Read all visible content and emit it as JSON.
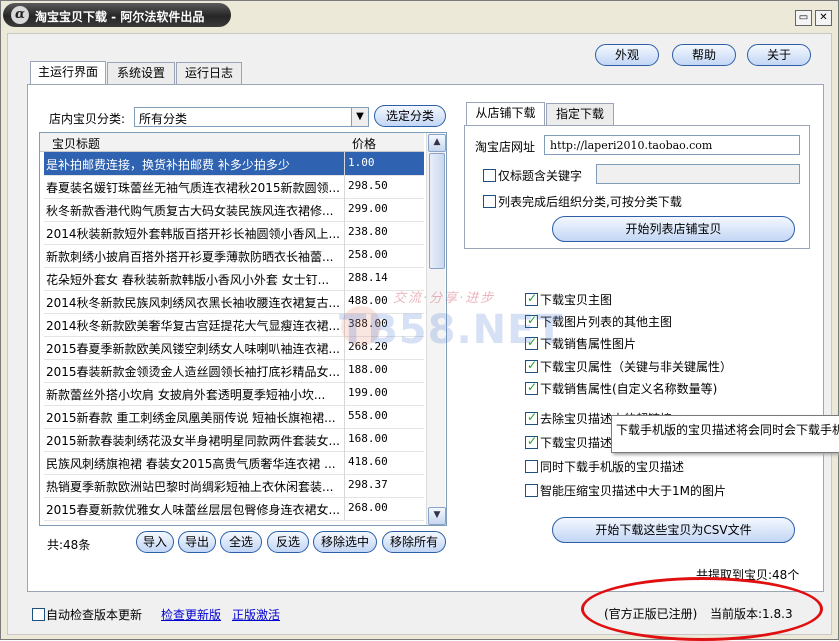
{
  "title": "淘宝宝贝下载 - 阿尔法软件出品",
  "logo_char": "α",
  "window_buttons": {
    "minimize": "▭",
    "close": "✕"
  },
  "top_buttons": [
    "外观",
    "帮助",
    "关于"
  ],
  "main_tabs": [
    "主运行界面",
    "系统设置",
    "运行日志"
  ],
  "category": {
    "label": "店内宝贝分类:",
    "value": "所有分类",
    "button": "选定分类"
  },
  "list": {
    "columns": [
      "宝贝标题",
      "价格"
    ],
    "rows": [
      {
        "title": "是补拍邮费连接，换货补拍邮费 补多少拍多少",
        "price": "1.00"
      },
      {
        "title": "春夏装名媛钉珠蕾丝无袖气质连衣裙秋2015新款圆领...",
        "price": "298.50"
      },
      {
        "title": "秋冬新款香港代购气质复古大码女装民族风连衣裙修...",
        "price": "299.00"
      },
      {
        "title": "2014秋装新款短外套韩版百搭开衫长袖圆领小香风上...",
        "price": "238.80"
      },
      {
        "title": "新款刺绣小披肩百搭外搭开衫夏季薄款防晒衣长袖蕾...",
        "price": "258.00"
      },
      {
        "title": "花朵短外套女 春秋装新款韩版小香风小外套 女士钉...",
        "price": "288.14"
      },
      {
        "title": "2014秋冬新款民族风刺绣风衣黑长袖收腰连衣裙复古...",
        "price": "488.00"
      },
      {
        "title": "2014秋冬新款欧美奢华复古宫廷提花大气显瘦连衣裙...",
        "price": "388.00"
      },
      {
        "title": "2015春夏季新款欧美风镂空刺绣女人味喇叭袖连衣裙...",
        "price": "268.20"
      },
      {
        "title": "2015春装新款金领烫金人造丝圆领长袖打底衫精品女...",
        "price": "188.00"
      },
      {
        "title": "新款蕾丝外搭小坎肩 女披肩外套透明夏季短袖小坎...",
        "price": "199.00"
      },
      {
        "title": "2015新春款 重工刺绣金凤凰美丽传说 短袖长旗袍裙...",
        "price": "558.00"
      },
      {
        "title": "2015新款春装刺绣花汲女半身裙明星同款两件套装女...",
        "price": "168.00"
      },
      {
        "title": "民族风刺绣旗袍裙 春装女2015高贵气质奢华连衣裙 ...",
        "price": "418.60"
      },
      {
        "title": "热销夏季新款欧洲站巴黎时尚绸彩短袖上衣休闲套装...",
        "price": "298.37"
      },
      {
        "title": "2015春夏新款优雅女人味蕾丝层层包臀修身连衣裙女...",
        "price": "268.00"
      }
    ]
  },
  "list_footer": {
    "count": "共:48条",
    "buttons": [
      "导入",
      "导出",
      "全选",
      "反选",
      "移除选中",
      "移除所有"
    ]
  },
  "right_tabs": [
    "从店铺下载",
    "指定下载"
  ],
  "shop": {
    "url_label": "淘宝店网址",
    "url_value": "http://laperi2010.taobao.com",
    "only_title_label": "仅标题含关键字",
    "only_title_checked": false,
    "organize_label": "列表完成后组织分类,可按分类下载",
    "organize_checked": false,
    "start_button": "开始列表店铺宝贝"
  },
  "options": [
    {
      "label": "下载宝贝主图",
      "checked": true
    },
    {
      "label": "下载图片列表的其他主图",
      "checked": true
    },
    {
      "label": "下载销售属性图片",
      "checked": true
    },
    {
      "label": "下载宝贝属性（关键与非关键属性）",
      "checked": true
    },
    {
      "label": "下载销售属性(自定义名称数量等)",
      "checked": true
    },
    {
      "label": "去除宝贝描述中的超链接",
      "checked": true
    },
    {
      "label": "下载宝贝描述中的图片用于图片搬家",
      "checked": true
    },
    {
      "label": "同时下载手机版的宝贝描述",
      "checked": false
    },
    {
      "label": "智能压缩宝贝描述中大于1M的图片",
      "checked": false
    }
  ],
  "tooltip": "下载手机版的宝贝描述将会同时会下载手机",
  "export_button": "开始下载这些宝贝为CSV文件",
  "total_status": "共提取到宝贝:48个",
  "footer": {
    "auto_check_label": "自动检查版本更新",
    "auto_check_checked": false,
    "check_update": "检查更新版",
    "activate": "正版激活",
    "registered": "(官方正版已注册)",
    "version_label": "当前版本:1.8.3"
  },
  "watermark": {
    "main": "TB58.NET",
    "sub": "交流·分享·进步"
  },
  "colors": {
    "selected_row": "#2f63b2",
    "annotation": "#e01010",
    "link": "#0000d0"
  }
}
